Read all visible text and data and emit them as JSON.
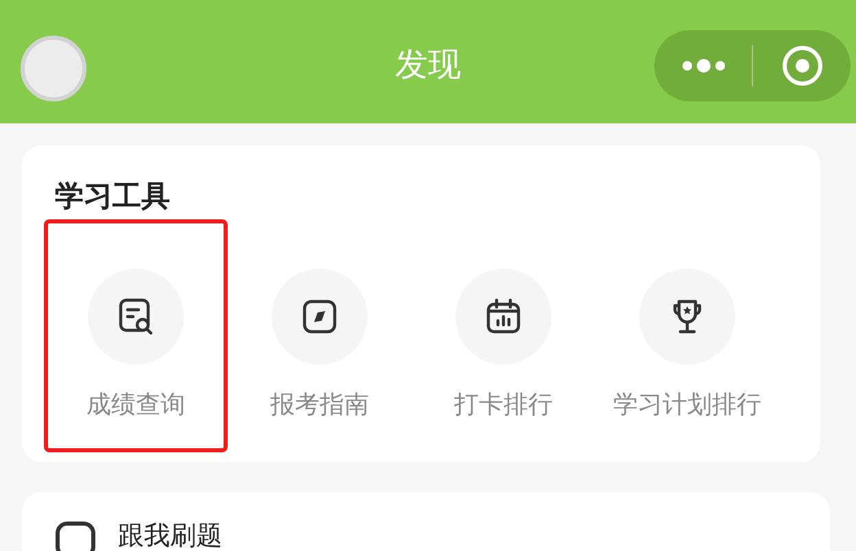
{
  "header": {
    "title": "发现"
  },
  "section": {
    "title": "学习工具",
    "tools": [
      {
        "kind": "report",
        "label": "成绩查询",
        "highlighted": true
      },
      {
        "kind": "compass",
        "label": "报考指南",
        "highlighted": false
      },
      {
        "kind": "calendar",
        "label": "打卡排行",
        "highlighted": false
      },
      {
        "kind": "trophy",
        "label": "学习计划排行",
        "highlighted": false
      }
    ]
  },
  "next_section": {
    "title": "跟我刷题"
  }
}
